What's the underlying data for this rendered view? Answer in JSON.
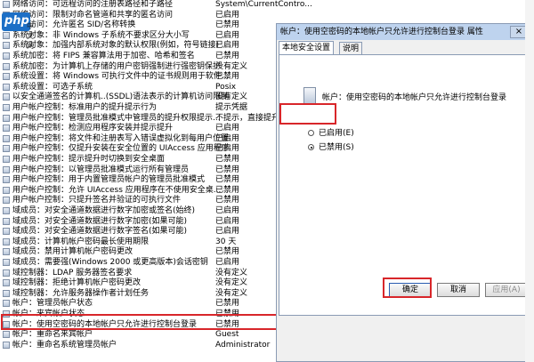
{
  "list_rows": [
    {
      "policy": "网络访问：可远程访问的注册表路径和子路径",
      "setting": "System\\CurrentContro..."
    },
    {
      "policy": "网络访问：限制对命名管道和共享的匿名访问",
      "setting": "已启用"
    },
    {
      "policy": "网络访问：允许匿名 SID/名称转换",
      "setting": "已禁用"
    },
    {
      "policy": "系统对象：非 Windows 子系统不要求区分大小写",
      "setting": "已启用"
    },
    {
      "policy": "系统对象：加强内部系统对象的默认权限(例如，符号链接)",
      "setting": "已启用"
    },
    {
      "policy": "系统加密：将 FIPS 兼容算法用于加密、哈希和签名",
      "setting": "已禁用"
    },
    {
      "policy": "系统加密：为计算机上存储的用户密钥强制进行强密钥保护",
      "setting": "没有定义"
    },
    {
      "policy": "系统设置：将 Windows 可执行文件中的证书规则用于软件...",
      "setting": "已禁用"
    },
    {
      "policy": "系统设置：可选子系统",
      "setting": "Posix"
    },
    {
      "policy": "以安全通道签名的计算机..(SSDL)语法表示的计算机访问限制",
      "setting": "没有定义"
    },
    {
      "policy": "用户帐户控制：标准用户的提升提示行为",
      "setting": "提示凭据"
    },
    {
      "policy": "用户帐户控制：管理员批准模式中管理员的提升权限提示...",
      "setting": "不提示，直接提升"
    },
    {
      "policy": "用户帐户控制：检测应用程序安装并提示提升",
      "setting": "已启用"
    },
    {
      "policy": "用户帐户控制：将文件和注册表写入错误虚拟化到每用户位置",
      "setting": "已启用"
    },
    {
      "policy": "用户帐户控制：仅提升安装在安全位置的 UIAccess 应用程序",
      "setting": "已启用"
    },
    {
      "policy": "用户帐户控制：提示提升时切换到安全桌面",
      "setting": "已禁用"
    },
    {
      "policy": "用户帐户控制：以管理员批准模式运行所有管理员",
      "setting": "已禁用"
    },
    {
      "policy": "用户帐户控制：用于内置管理员帐户的管理员批准模式",
      "setting": "已禁用"
    },
    {
      "policy": "用户帐户控制：允许 UIAccess 应用程序在不使用安全桌...",
      "setting": "已禁用"
    },
    {
      "policy": "用户帐户控制：只提升签名并验证的可执行文件",
      "setting": "已禁用"
    },
    {
      "policy": "域成员：对安全通道数据进行数字加密或签名(始终)",
      "setting": "已启用"
    },
    {
      "policy": "域成员：对安全通道数据进行数字加密(如果可能)",
      "setting": "已启用"
    },
    {
      "policy": "域成员：对安全通道数据进行数字签名(如果可能)",
      "setting": "已启用"
    },
    {
      "policy": "域成员：计算机帐户密码最长使用期限",
      "setting": "30 天"
    },
    {
      "policy": "域成员：禁用计算机帐户密码更改",
      "setting": "已禁用"
    },
    {
      "policy": "域成员：需要强(Windows 2000 或更高版本)会话密钥",
      "setting": "已启用"
    },
    {
      "policy": "域控制器：LDAP 服务器签名要求",
      "setting": "没有定义"
    },
    {
      "policy": "域控制器：拒绝计算机帐户密码更改",
      "setting": "没有定义"
    },
    {
      "policy": "域控制器：允许服务器操作者计划任务",
      "setting": "没有定义"
    },
    {
      "policy": "帐户：管理员帐户状态",
      "setting": "已禁用"
    },
    {
      "policy": "帐户：来宾帐户状态",
      "setting": "已禁用"
    },
    {
      "policy": "帐户：使用空密码的本地帐户只允许进行控制台登录",
      "setting": "已禁用"
    },
    {
      "policy": "帐户：重命名来宾帐户",
      "setting": "Guest"
    },
    {
      "policy": "帐户：重命名系统管理员帐户",
      "setting": "Administrator"
    }
  ],
  "watermark": {
    "brand": "php",
    "site": "中文网"
  },
  "dialog": {
    "title": "帐户：使用空密码的本地帐户只允许进行控制台登录 属性",
    "close": "×",
    "tabs": [
      "本地安全设置",
      "说明"
    ],
    "policy_name": "帐户：使用空密码的本地帐户只允许进行控制台登录",
    "options": [
      "已启用(E)",
      "已禁用(S)"
    ],
    "selected": "已禁用(S)",
    "buttons": {
      "ok": "确定",
      "cancel": "取消",
      "apply": "应用(A)"
    }
  },
  "colors": {
    "highlight": "#d8262a",
    "title_bar": "#bed3ee"
  }
}
